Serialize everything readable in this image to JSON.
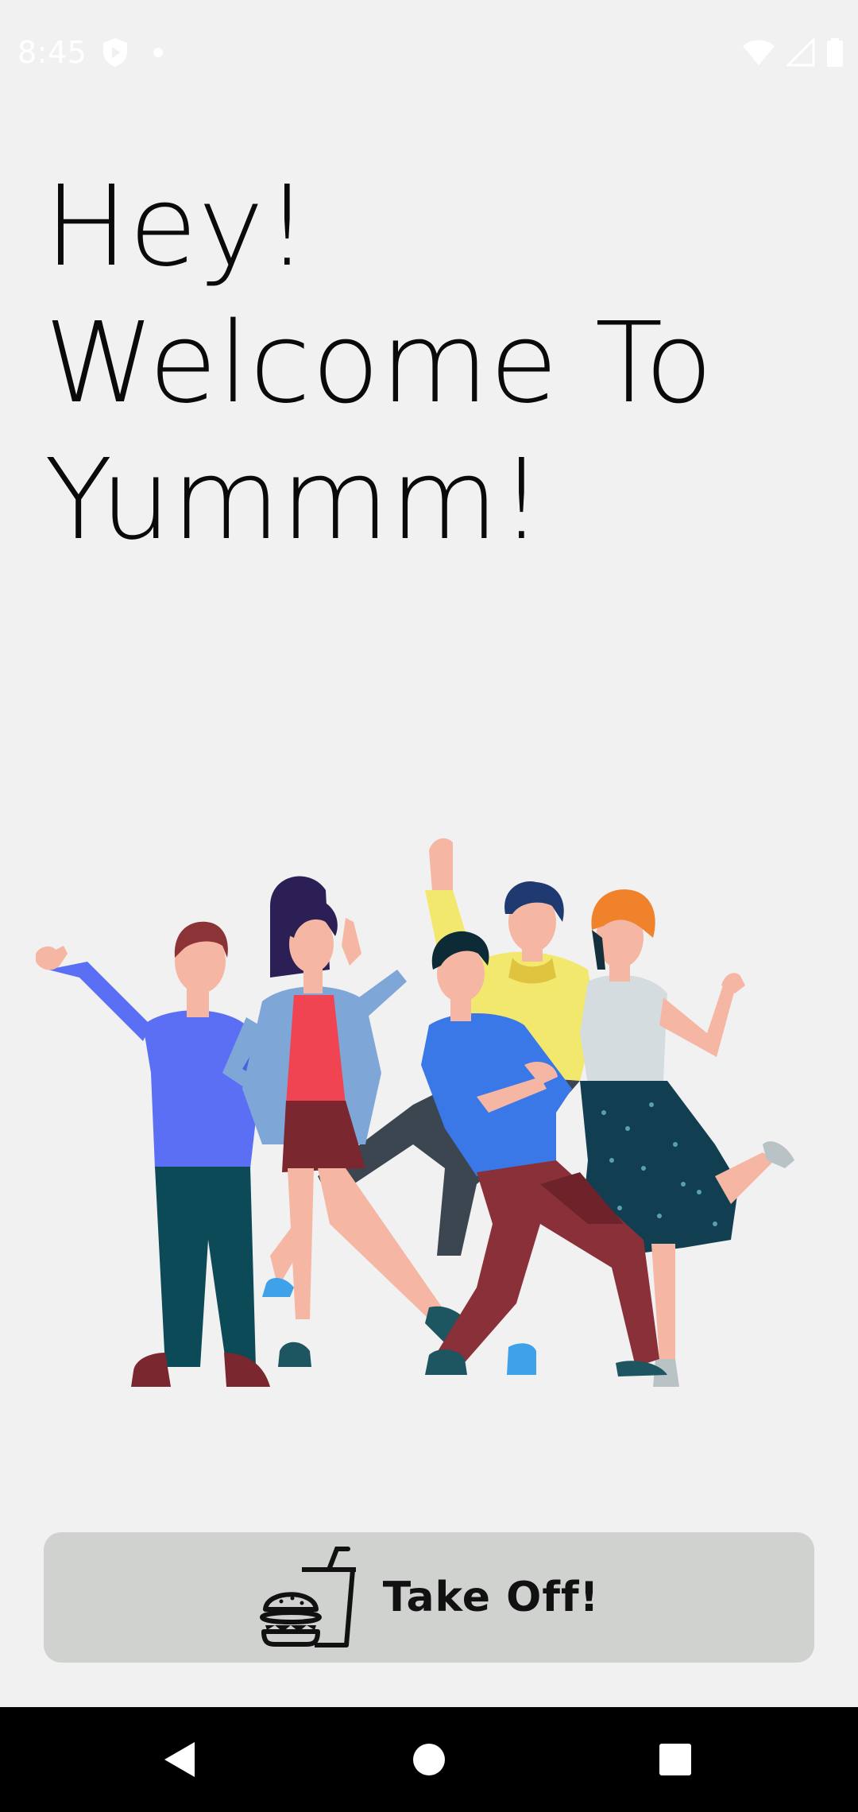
{
  "status_bar": {
    "time": "8:45",
    "icons": [
      "play-protect-icon",
      "notification-dot-icon",
      "wifi-icon",
      "cellular-signal-icon",
      "battery-icon"
    ]
  },
  "headline": {
    "line1": "Hey!",
    "line2": "Welcome To",
    "line3": "Yummm!"
  },
  "illustration": {
    "icon": "group-of-friends-illustration"
  },
  "primary_button": {
    "label": "Take Off!",
    "icon": "burger-and-drink-icon",
    "background": "#cfd2ce"
  },
  "nav_bar": {
    "buttons": [
      "back-icon",
      "home-icon",
      "recents-icon"
    ]
  },
  "colors": {
    "background": "#f2f1f2",
    "text": "#0a0a0a",
    "nav_bar": "#000000"
  }
}
